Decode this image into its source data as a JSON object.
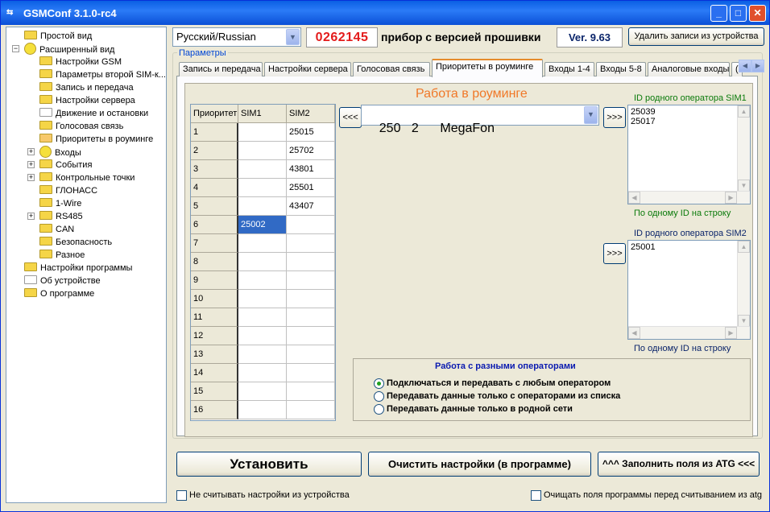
{
  "window": {
    "title": "GSMConf 3.1.0-rc4",
    "minimize": "_",
    "maximize": "□",
    "close": "✕"
  },
  "tree": [
    {
      "label": "Простой вид",
      "indent": 0,
      "icon": "folder"
    },
    {
      "label": "Расширенный вид",
      "indent": 0,
      "icon": "circle",
      "expander": "−"
    },
    {
      "label": "Настройки GSM",
      "indent": 1,
      "icon": "folder"
    },
    {
      "label": "Параметры второй SIM-к...",
      "indent": 1,
      "icon": "folder"
    },
    {
      "label": "Запись и передача",
      "indent": 1,
      "icon": "folder"
    },
    {
      "label": "Настройки сервера",
      "indent": 1,
      "icon": "folder"
    },
    {
      "label": "Движение и остановки",
      "indent": 1,
      "icon": "folder-white"
    },
    {
      "label": "Голосовая связь",
      "indent": 1,
      "icon": "folder"
    },
    {
      "label": "Приоритеты в роуминге",
      "indent": 1,
      "icon": "folder-open"
    },
    {
      "label": "Входы",
      "indent": 1,
      "icon": "circle",
      "expander": "+"
    },
    {
      "label": "События",
      "indent": 1,
      "icon": "folder",
      "expander": "+"
    },
    {
      "label": "Контрольные точки",
      "indent": 1,
      "icon": "folder",
      "expander": "+"
    },
    {
      "label": "ГЛОНАСС",
      "indent": 1,
      "icon": "folder"
    },
    {
      "label": "1-Wire",
      "indent": 1,
      "icon": "folder"
    },
    {
      "label": "RS485",
      "indent": 1,
      "icon": "folder",
      "expander": "+"
    },
    {
      "label": "CAN",
      "indent": 1,
      "icon": "folder"
    },
    {
      "label": "Безопасность",
      "indent": 1,
      "icon": "folder"
    },
    {
      "label": "Разное",
      "indent": 1,
      "icon": "folder"
    },
    {
      "label": "Настройки программы",
      "indent": 0,
      "icon": "folder"
    },
    {
      "label": "Об устройстве",
      "indent": 0,
      "icon": "folder-white"
    },
    {
      "label": "О программе",
      "indent": 0,
      "icon": "folder"
    }
  ],
  "header": {
    "language": "Русский/Russian",
    "serial": "0262145",
    "firmware_text": "прибор с версией прошивки",
    "version": "Ver. 9.63",
    "delete_button": "Удалить записи из устройства"
  },
  "params_label": "Параметры",
  "tabs": [
    "Запись и передача",
    "Настройки сервера",
    "Голосовая связь",
    "Приоритеты в роуминге",
    "Входы 1-4",
    "Входы 5-8",
    "Аналоговые входы",
    "("
  ],
  "active_tab": 3,
  "roaming": {
    "title": "Работа в роуминге",
    "grid_headers": [
      "Приоритет",
      "SIM1",
      "SIM2"
    ],
    "rows": [
      {
        "p": "1",
        "sim1": "",
        "sim2": "25015"
      },
      {
        "p": "2",
        "sim1": "",
        "sim2": "25702"
      },
      {
        "p": "3",
        "sim1": "",
        "sim2": "43801"
      },
      {
        "p": "4",
        "sim1": "",
        "sim2": "25501"
      },
      {
        "p": "5",
        "sim1": "",
        "sim2": "43407"
      },
      {
        "p": "6",
        "sim1": "25002",
        "sim2": ""
      },
      {
        "p": "7",
        "sim1": "",
        "sim2": ""
      },
      {
        "p": "8",
        "sim1": "",
        "sim2": ""
      },
      {
        "p": "9",
        "sim1": "",
        "sim2": ""
      },
      {
        "p": "10",
        "sim1": "",
        "sim2": ""
      },
      {
        "p": "11",
        "sim1": "",
        "sim2": ""
      },
      {
        "p": "12",
        "sim1": "",
        "sim2": ""
      },
      {
        "p": "13",
        "sim1": "",
        "sim2": ""
      },
      {
        "p": "14",
        "sim1": "",
        "sim2": ""
      },
      {
        "p": "15",
        "sim1": "",
        "sim2": ""
      },
      {
        "p": "16",
        "sim1": "",
        "sim2": ""
      }
    ],
    "selected_row": 5,
    "operator_select": "250   2      MegaFon",
    "move_left": "<<<",
    "move_right": ">>>",
    "sim1_home_label": "ID родного оператора SIM1",
    "sim1_home_ids": [
      "25039",
      "25017"
    ],
    "sim1_hint": "По одному ID на строку",
    "sim2_home_label": "ID родного оператора SIM2",
    "sim2_home_ids": [
      "25001"
    ],
    "sim2_hint": "По одному ID на строку"
  },
  "operators": {
    "title": "Работа с разными операторами",
    "options": [
      "Подключаться и передавать с любым оператором",
      "Передавать данные только с операторами из списка",
      "Передавать данные только в родной сети"
    ],
    "selected": 0
  },
  "footer": {
    "install": "Установить",
    "clear": "Очистить настройки (в программе)",
    "fill": "^^^ Заполнить поля из ATG <<<",
    "no_read_label": "Не считывать настройки из устройства",
    "clear_before_read_label": "Очищать поля программы перед считыванием из atg"
  }
}
